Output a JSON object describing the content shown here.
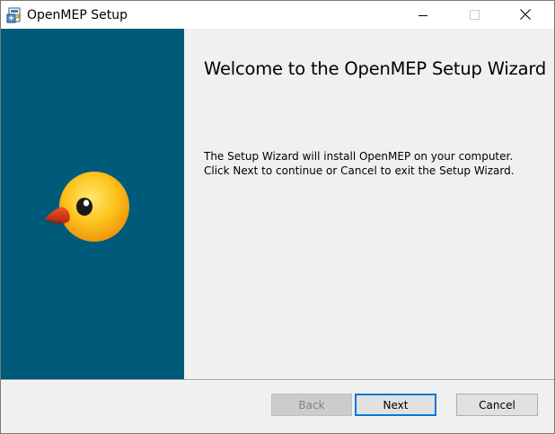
{
  "window": {
    "title": "OpenMEP Setup",
    "icon": "installer-icon",
    "controls": {
      "minimize": "minimize-icon",
      "maximize": "maximize-icon",
      "close": "close-icon"
    }
  },
  "banner": {
    "background_color": "#005a7a",
    "image": "duck-icon"
  },
  "content": {
    "heading": "Welcome to the OpenMEP Setup Wizard",
    "body": "The Setup Wizard will install OpenMEP on your computer. Click Next to continue or Cancel to exit the Setup Wizard."
  },
  "footer": {
    "back_label": "Back",
    "next_label": "Next",
    "cancel_label": "Cancel",
    "accent_color": "#0078d7"
  }
}
